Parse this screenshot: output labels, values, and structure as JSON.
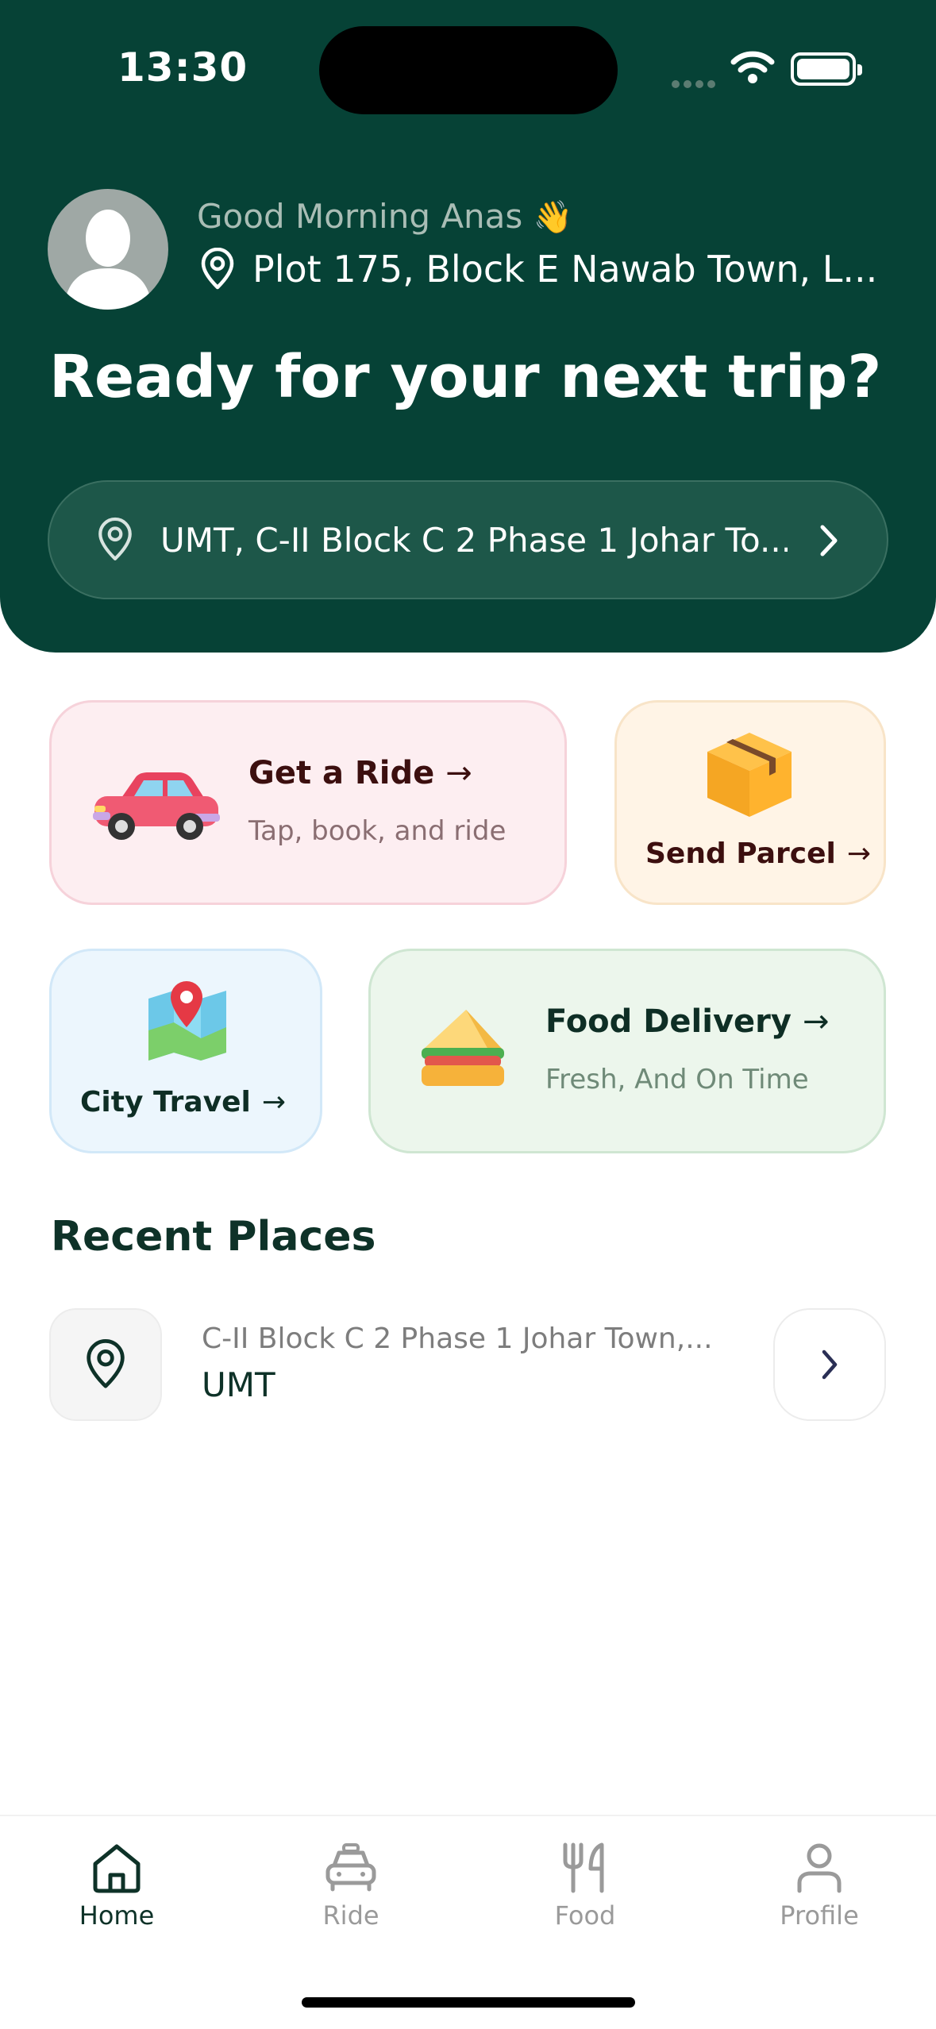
{
  "status_bar": {
    "time": "13:30"
  },
  "header": {
    "greeting": "Good Morning Anas",
    "greeting_emoji": "👋",
    "current_location": "Plot 175, Block E Nawab Town, L...",
    "headline": "Ready for your next trip?",
    "destination_search": "UMT, C-II Block C 2 Phase 1 Johar To..."
  },
  "services": {
    "ride": {
      "title": "Get a Ride",
      "subtitle": "Tap, book, and ride",
      "arrow": "→"
    },
    "parcel": {
      "title": "Send Parcel",
      "arrow": "→"
    },
    "city": {
      "title": "City Travel",
      "arrow": "→"
    },
    "food": {
      "title": "Food Delivery",
      "subtitle": "Fresh, And On Time",
      "arrow": "→"
    }
  },
  "recent": {
    "title": "Recent Places",
    "items": [
      {
        "address": "C-II Block C 2 Phase 1 Johar Town,...",
        "name": "UMT"
      }
    ]
  },
  "bottom_nav": {
    "items": [
      {
        "label": "Home",
        "icon": "home-icon",
        "active": true
      },
      {
        "label": "Ride",
        "icon": "car-icon",
        "active": false
      },
      {
        "label": "Food",
        "icon": "fork-knife-icon",
        "active": false
      },
      {
        "label": "Profile",
        "icon": "person-icon",
        "active": false
      }
    ]
  },
  "colors": {
    "header_bg": "#064236",
    "accent_dark": "#0e3228",
    "nav_inactive": "#9a9a9a",
    "ride_card_bg": "#fdeef1",
    "parcel_card_bg": "#fff4e6",
    "city_card_bg": "#ecf6fd",
    "food_card_bg": "#ecf6ec"
  }
}
